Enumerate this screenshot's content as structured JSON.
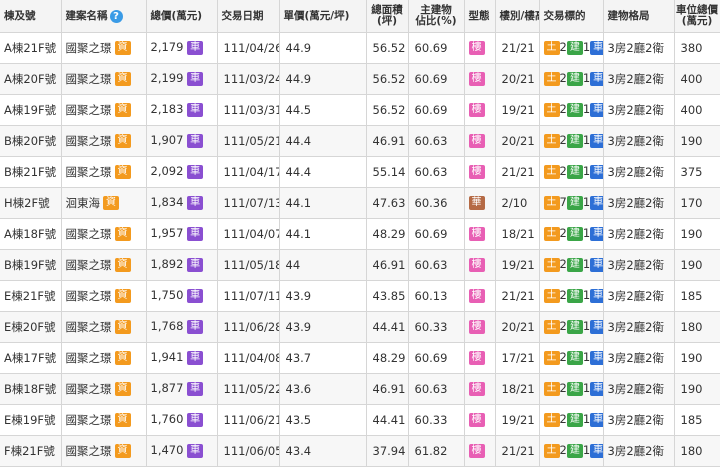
{
  "headers": {
    "unit": "棟及號",
    "project": "建案名稱",
    "help_icon": "?",
    "total_price": "總價(萬元)",
    "date": "交易日期",
    "unit_price": "單價(萬元/坪)",
    "area": [
      "總面積",
      "(坪)"
    ],
    "main_ratio": [
      "主建物",
      "佔比(%)"
    ],
    "type": "型態",
    "floor": "樓別/樓高",
    "target": "交易標的",
    "layout": "建物格局",
    "parking": [
      "車位總價",
      "(萬元)"
    ]
  },
  "colors": {
    "ad_badge": "#f39a1e",
    "parking_badge": "#8a4fd1",
    "building_badge": "#e85fb4",
    "house_badge": "#b56a45",
    "land_badge": "#f39a1e",
    "build_badge": "#3aa547",
    "car_badge": "#2d6fd6"
  },
  "rows": [
    {
      "unit": "A棟21F號",
      "project": "國聚之璟",
      "ad": "資",
      "price": "2,179",
      "car": "車",
      "date": "111/04/26",
      "unit_price": "44.9",
      "area": "56.52",
      "ratio": "60.69",
      "type": "樓",
      "type_kind": "building",
      "floor": "21/21",
      "land": "土",
      "land_n": "2",
      "build": "建",
      "build_n": "1",
      "carb": "車",
      "car_n": "2",
      "layout": "3房2廳2衛",
      "parking": "380"
    },
    {
      "unit": "A棟20F號",
      "project": "國聚之璟",
      "ad": "資",
      "price": "2,199",
      "car": "車",
      "date": "111/03/24",
      "unit_price": "44.9",
      "area": "56.52",
      "ratio": "60.69",
      "type": "樓",
      "type_kind": "building",
      "floor": "20/21",
      "land": "土",
      "land_n": "2",
      "build": "建",
      "build_n": "1",
      "carb": "車",
      "car_n": "2",
      "layout": "3房2廳2衛",
      "parking": "400"
    },
    {
      "unit": "A棟19F號",
      "project": "國聚之璟",
      "ad": "資",
      "price": "2,183",
      "car": "車",
      "date": "111/03/31",
      "unit_price": "44.5",
      "area": "56.52",
      "ratio": "60.69",
      "type": "樓",
      "type_kind": "building",
      "floor": "19/21",
      "land": "土",
      "land_n": "2",
      "build": "建",
      "build_n": "1",
      "carb": "車",
      "car_n": "2",
      "layout": "3房2廳2衛",
      "parking": "400"
    },
    {
      "unit": "B棟20F號",
      "project": "國聚之璟",
      "ad": "資",
      "price": "1,907",
      "car": "車",
      "date": "111/05/21",
      "unit_price": "44.4",
      "area": "46.91",
      "ratio": "60.63",
      "type": "樓",
      "type_kind": "building",
      "floor": "20/21",
      "land": "土",
      "land_n": "2",
      "build": "建",
      "build_n": "1",
      "carb": "車",
      "car_n": "1",
      "layout": "3房2廳2衛",
      "parking": "190"
    },
    {
      "unit": "B棟21F號",
      "project": "國聚之璟",
      "ad": "資",
      "price": "2,092",
      "car": "車",
      "date": "111/04/17",
      "unit_price": "44.4",
      "area": "55.14",
      "ratio": "60.63",
      "type": "樓",
      "type_kind": "building",
      "floor": "21/21",
      "land": "土",
      "land_n": "2",
      "build": "建",
      "build_n": "1",
      "carb": "車",
      "car_n": "2",
      "layout": "3房2廳2衛",
      "parking": "375"
    },
    {
      "unit": "H棟2F號",
      "project": "洄東海",
      "ad": "資",
      "price": "1,834",
      "car": "車",
      "date": "111/07/13",
      "unit_price": "44.1",
      "area": "47.63",
      "ratio": "60.36",
      "type": "華",
      "type_kind": "house",
      "floor": "2/10",
      "land": "土",
      "land_n": "7",
      "build": "建",
      "build_n": "1",
      "carb": "車",
      "car_n": "1",
      "layout": "3房2廳2衛",
      "parking": "170"
    },
    {
      "unit": "A棟18F號",
      "project": "國聚之璟",
      "ad": "資",
      "price": "1,957",
      "car": "車",
      "date": "111/04/07",
      "unit_price": "44.1",
      "area": "48.29",
      "ratio": "60.69",
      "type": "樓",
      "type_kind": "building",
      "floor": "18/21",
      "land": "土",
      "land_n": "2",
      "build": "建",
      "build_n": "1",
      "carb": "車",
      "car_n": "1",
      "layout": "3房2廳2衛",
      "parking": "190"
    },
    {
      "unit": "B棟19F號",
      "project": "國聚之璟",
      "ad": "資",
      "price": "1,892",
      "car": "車",
      "date": "111/05/18",
      "unit_price": "44",
      "area": "46.91",
      "ratio": "60.63",
      "type": "樓",
      "type_kind": "building",
      "floor": "19/21",
      "land": "土",
      "land_n": "2",
      "build": "建",
      "build_n": "1",
      "carb": "車",
      "car_n": "1",
      "layout": "3房2廳2衛",
      "parking": "190"
    },
    {
      "unit": "E棟21F號",
      "project": "國聚之璟",
      "ad": "資",
      "price": "1,750",
      "car": "車",
      "date": "111/07/11",
      "unit_price": "43.9",
      "area": "43.85",
      "ratio": "60.13",
      "type": "樓",
      "type_kind": "building",
      "floor": "21/21",
      "land": "土",
      "land_n": "2",
      "build": "建",
      "build_n": "1",
      "carb": "車",
      "car_n": "1",
      "layout": "3房2廳2衛",
      "parking": "185"
    },
    {
      "unit": "E棟20F號",
      "project": "國聚之璟",
      "ad": "資",
      "price": "1,768",
      "car": "車",
      "date": "111/06/28",
      "unit_price": "43.9",
      "area": "44.41",
      "ratio": "60.33",
      "type": "樓",
      "type_kind": "building",
      "floor": "20/21",
      "land": "土",
      "land_n": "2",
      "build": "建",
      "build_n": "1",
      "carb": "車",
      "car_n": "1",
      "layout": "3房2廳2衛",
      "parking": "180"
    },
    {
      "unit": "A棟17F號",
      "project": "國聚之璟",
      "ad": "資",
      "price": "1,941",
      "car": "車",
      "date": "111/04/08",
      "unit_price": "43.7",
      "area": "48.29",
      "ratio": "60.69",
      "type": "樓",
      "type_kind": "building",
      "floor": "17/21",
      "land": "土",
      "land_n": "2",
      "build": "建",
      "build_n": "1",
      "carb": "車",
      "car_n": "1",
      "layout": "3房2廳2衛",
      "parking": "190"
    },
    {
      "unit": "B棟18F號",
      "project": "國聚之璟",
      "ad": "資",
      "price": "1,877",
      "car": "車",
      "date": "111/05/22",
      "unit_price": "43.6",
      "area": "46.91",
      "ratio": "60.63",
      "type": "樓",
      "type_kind": "building",
      "floor": "18/21",
      "land": "土",
      "land_n": "2",
      "build": "建",
      "build_n": "1",
      "carb": "車",
      "car_n": "1",
      "layout": "3房2廳2衛",
      "parking": "190"
    },
    {
      "unit": "E棟19F號",
      "project": "國聚之璟",
      "ad": "資",
      "price": "1,760",
      "car": "車",
      "date": "111/06/21",
      "unit_price": "43.5",
      "area": "44.41",
      "ratio": "60.33",
      "type": "樓",
      "type_kind": "building",
      "floor": "19/21",
      "land": "土",
      "land_n": "2",
      "build": "建",
      "build_n": "1",
      "carb": "車",
      "car_n": "1",
      "layout": "3房2廳2衛",
      "parking": "185"
    },
    {
      "unit": "F棟21F號",
      "project": "國聚之璟",
      "ad": "資",
      "price": "1,470",
      "car": "車",
      "date": "111/06/05",
      "unit_price": "43.4",
      "area": "37.94",
      "ratio": "61.82",
      "type": "樓",
      "type_kind": "building",
      "floor": "21/21",
      "land": "土",
      "land_n": "2",
      "build": "建",
      "build_n": "1",
      "carb": "車",
      "car_n": "2",
      "layout": "3房2廳2衛",
      "parking": "180"
    }
  ]
}
